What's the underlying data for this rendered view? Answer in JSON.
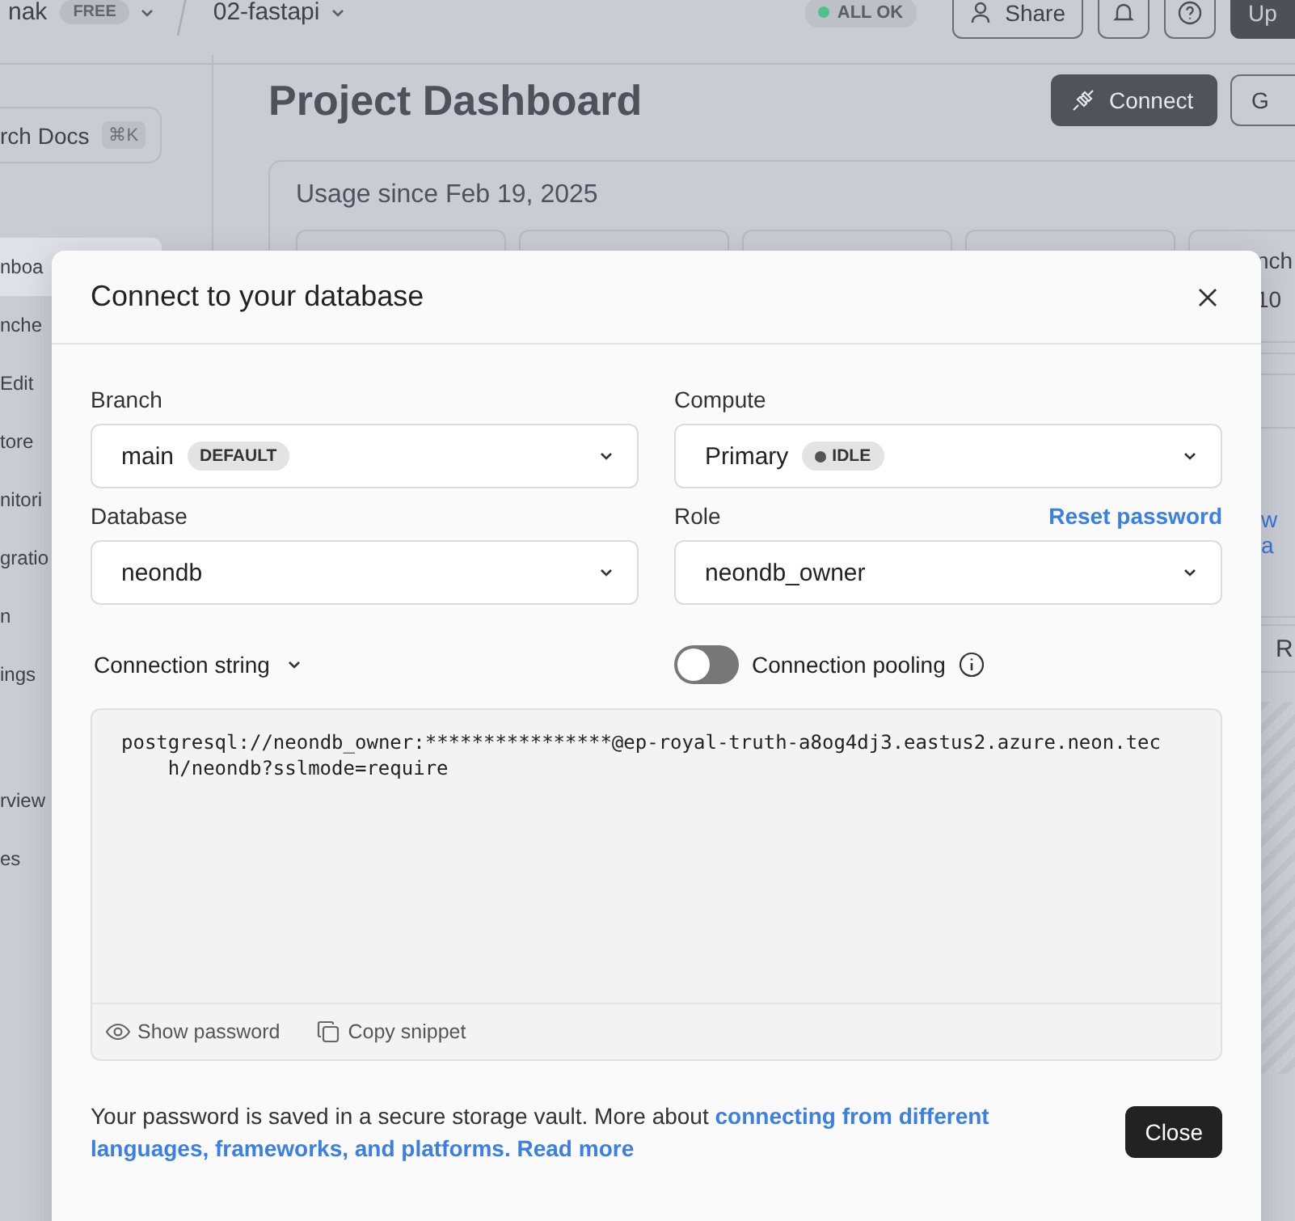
{
  "topbar": {
    "org": "nak",
    "org_badge": "FREE",
    "project": "02-fastapi",
    "status": {
      "label": "ALL OK",
      "color": "#4cc38a"
    },
    "share_button": "Share",
    "upgrade_button": "Up"
  },
  "sidebar": {
    "search": {
      "label": "rch Docs",
      "shortcut": "⌘K"
    },
    "groups": [
      [
        {
          "label": "nboa",
          "selected": true
        },
        {
          "label": "nche",
          "selected": false
        },
        {
          "label": "Edit",
          "selected": false
        },
        {
          "label": "tore",
          "selected": false
        },
        {
          "label": "nitori",
          "selected": false
        },
        {
          "label": "gratio",
          "selected": false
        },
        {
          "label": "n",
          "selected": false
        },
        {
          "label": "ings",
          "selected": false
        }
      ],
      [
        {
          "label": "rview",
          "selected": false
        },
        {
          "label": "es",
          "selected": false
        }
      ]
    ]
  },
  "main": {
    "title": "Project Dashboard",
    "connect_button": "Connect",
    "next_button": "G",
    "usage_title": "Usage since Feb 19, 2025",
    "usage_card": {
      "label": "nch",
      "value": "10"
    },
    "link": "w a",
    "button": "R"
  },
  "dialog": {
    "title": "Connect to your database",
    "fields": [
      {
        "label": "Branch",
        "value": "main",
        "badge": {
          "text": "DEFAULT",
          "dot": false
        }
      },
      {
        "label": "Compute",
        "value": "Primary",
        "badge": {
          "text": "IDLE",
          "dot": true
        }
      },
      {
        "label": "Database",
        "value": "neondb"
      },
      {
        "label": "Role",
        "value": "neondb_owner",
        "action": "Reset password"
      }
    ],
    "connection_string": {
      "label": "Connection string"
    },
    "pooling": {
      "label": "Connection pooling",
      "on": false
    },
    "code": "postgresql://neondb_owner:****************@ep-royal-truth-a8og4dj3.eastus2.azure.neon.tech/neondb?sslmode=require",
    "show_password": "Show password",
    "copy_snippet": "Copy snippet",
    "note": {
      "text": "Your password is saved in a secure storage vault. More about",
      "link": "connecting from different languages, frameworks, and platforms.",
      "read_more": "Read more"
    },
    "close_button": "Close"
  }
}
